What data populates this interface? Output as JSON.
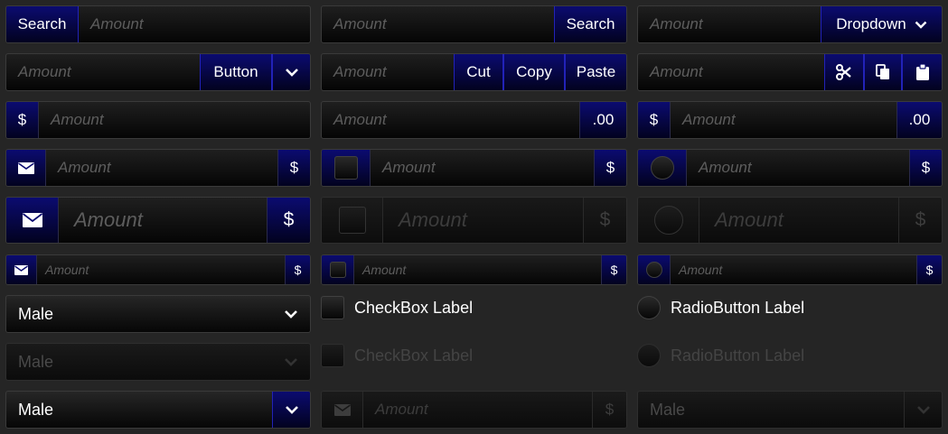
{
  "placeholder": "Amount",
  "labels": {
    "search": "Search",
    "dropdown": "Dropdown",
    "button": "Button",
    "cut": "Cut",
    "copy": "Copy",
    "paste": "Paste",
    "dollar": "$",
    "cents": ".00",
    "checkbox_label": "CheckBox Label",
    "radio_label": "RadioButton Label"
  },
  "combos": {
    "gender_1": "Male",
    "gender_2": "Male",
    "gender_3": "Male",
    "gender_4": "Male"
  },
  "colors": {
    "accent": "#0b0b70",
    "accent_border": "#2222b8",
    "background": "#252525"
  }
}
